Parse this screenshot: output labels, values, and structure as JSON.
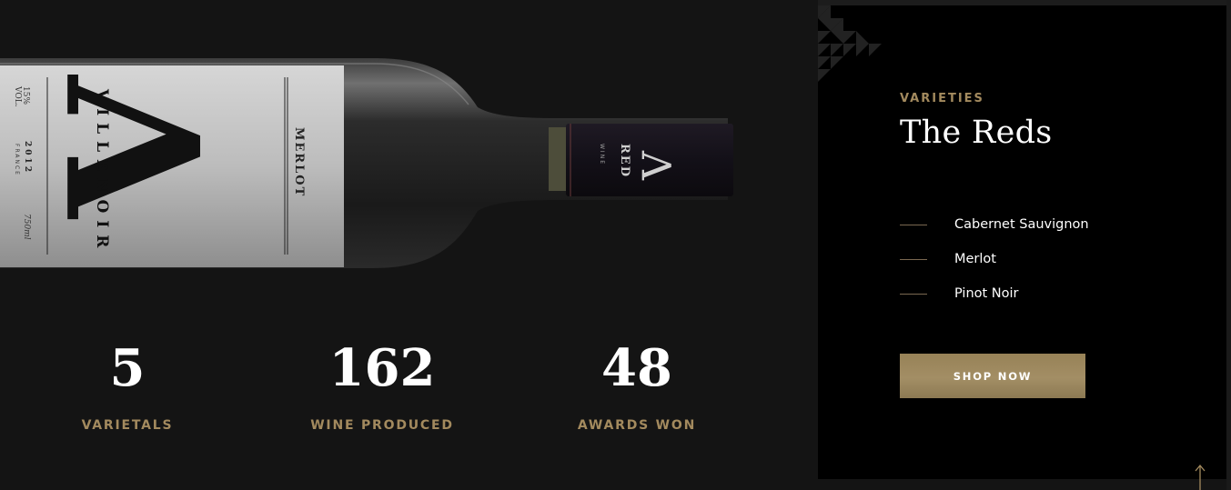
{
  "bottle": {
    "label_brand": "VILLENOIR",
    "label_monogram": "V",
    "label_variety": "MERLOT",
    "label_year": "2012",
    "label_country": "FRANCE",
    "label_abv": "15%",
    "label_vol": "VOL.",
    "label_size": "750ml",
    "cap_text": "RED",
    "cap_sub": "WINE",
    "cap_monogram": "V"
  },
  "stats": [
    {
      "value": "5",
      "label": "VARIETALS"
    },
    {
      "value": "162",
      "label": "WINE PRODUCED"
    },
    {
      "value": "48",
      "label": "AWARDS WON"
    }
  ],
  "panel": {
    "eyebrow": "VARIETIES",
    "title": "The Reds",
    "varieties": [
      "Cabernet Sauvignon",
      "Merlot",
      "Pinot Noir"
    ],
    "button_label": "SHOP NOW"
  },
  "colors": {
    "accent_gold": "#a38a5e",
    "background": "#141414",
    "panel_bg": "#000000",
    "text": "#ffffff"
  },
  "icons": {
    "scroll_top": "arrow-up-icon",
    "decor": "triangle-pattern-icon"
  }
}
